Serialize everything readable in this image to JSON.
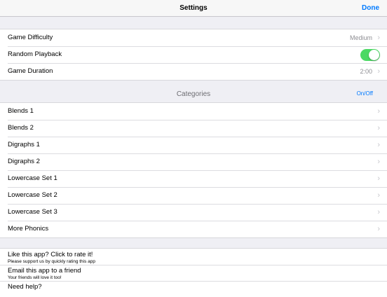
{
  "navbar": {
    "title": "Settings",
    "done_label": "Done"
  },
  "settings": {
    "difficulty_label": "Game Difficulty",
    "difficulty_value": "Medium",
    "random_label": "Random Playback",
    "random_on": true,
    "duration_label": "Game Duration",
    "duration_value": "2:00"
  },
  "categories": {
    "title": "Categories",
    "onoff_label": "On/Off",
    "items": [
      {
        "label": "Blends 1"
      },
      {
        "label": "Blends 2"
      },
      {
        "label": "Digraphs 1"
      },
      {
        "label": "Digraphs 2"
      },
      {
        "label": "Lowercase Set 1"
      },
      {
        "label": "Lowercase Set 2"
      },
      {
        "label": "Lowercase Set 3"
      },
      {
        "label": "More Phonics"
      }
    ]
  },
  "promo": [
    {
      "title": "Like this app? Click to rate it!",
      "subtitle": "Please support us by quickly rating this app"
    },
    {
      "title": "Email this app to a friend",
      "subtitle": "Your friends will love it too!"
    },
    {
      "title": "Need help?",
      "subtitle": ""
    }
  ],
  "icons": {
    "chevron": "chevron-right-icon",
    "toggle": "toggle-switch"
  },
  "colors": {
    "accent": "#007aff",
    "toggle_on": "#4cd964",
    "background": "#efeff4"
  }
}
